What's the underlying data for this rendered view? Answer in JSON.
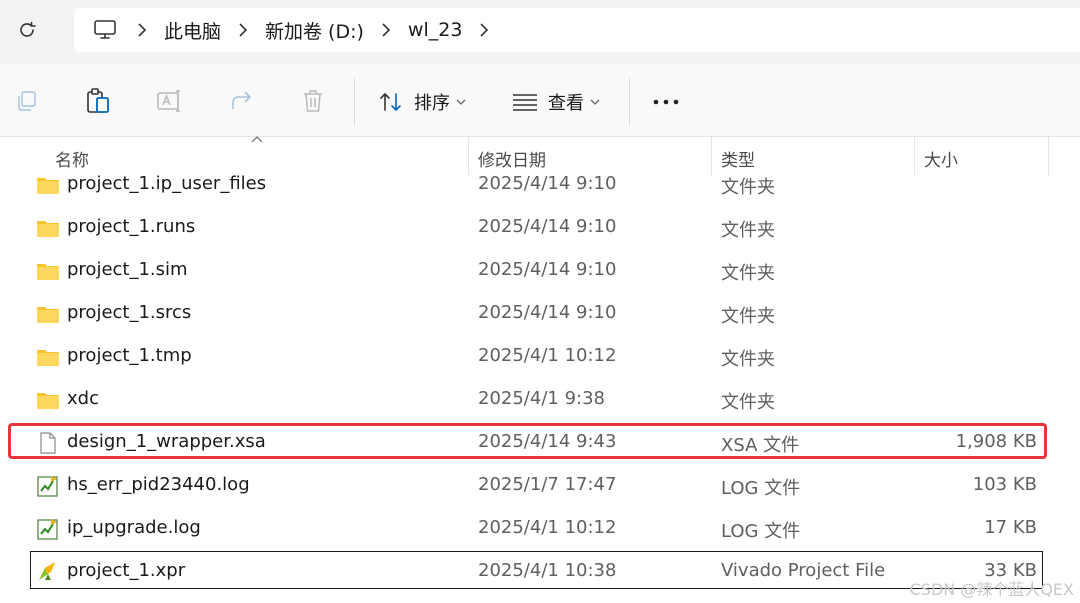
{
  "address_bar": {
    "breadcrumbs": [
      "此电脑",
      "新加卷 (D:)",
      "wl_23"
    ]
  },
  "toolbar": {
    "sort_label": "排序",
    "view_label": "查看",
    "more_label": "•••"
  },
  "columns": {
    "name": "名称",
    "date": "修改日期",
    "type": "类型",
    "size": "大小"
  },
  "files": [
    {
      "name": "project_1.ip_user_files",
      "date": "2025/4/14 9:10",
      "type": "文件夹",
      "size": "",
      "icon": "folder-icon"
    },
    {
      "name": "project_1.runs",
      "date": "2025/4/14 9:10",
      "type": "文件夹",
      "size": "",
      "icon": "folder-icon"
    },
    {
      "name": "project_1.sim",
      "date": "2025/4/14 9:10",
      "type": "文件夹",
      "size": "",
      "icon": "folder-icon"
    },
    {
      "name": "project_1.srcs",
      "date": "2025/4/14 9:10",
      "type": "文件夹",
      "size": "",
      "icon": "folder-icon"
    },
    {
      "name": "project_1.tmp",
      "date": "2025/4/1 10:12",
      "type": "文件夹",
      "size": "",
      "icon": "folder-icon"
    },
    {
      "name": "xdc",
      "date": "2025/4/1 9:38",
      "type": "文件夹",
      "size": "",
      "icon": "folder-icon"
    },
    {
      "name": "design_1_wrapper.xsa",
      "date": "2025/4/14 9:43",
      "type": "XSA 文件",
      "size": "1,908 KB",
      "icon": "file-icon"
    },
    {
      "name": "hs_err_pid23440.log",
      "date": "2025/1/7 17:47",
      "type": "LOG 文件",
      "size": "103 KB",
      "icon": "log-file-icon"
    },
    {
      "name": "ip_upgrade.log",
      "date": "2025/4/1 10:12",
      "type": "LOG 文件",
      "size": "17 KB",
      "icon": "log-file-icon"
    },
    {
      "name": "project_1.xpr",
      "date": "2025/4/1 10:38",
      "type": "Vivado Project File",
      "size": "33 KB",
      "icon": "vivado-icon"
    }
  ],
  "watermark": "CSDN @辣个蓝人QEX",
  "colors": {
    "highlight_border": "#e8353b",
    "folder": "#f8c42f",
    "accent": "#0067c0"
  }
}
